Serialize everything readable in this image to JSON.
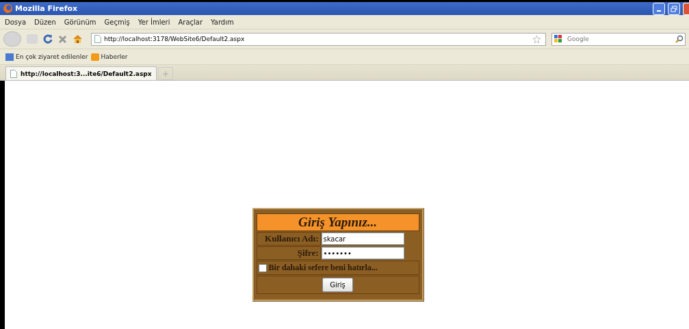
{
  "window": {
    "title": "Mozilla Firefox"
  },
  "menu": [
    "Dosya",
    "Düzen",
    "Görünüm",
    "Geçmiş",
    "Yer İmleri",
    "Araçlar",
    "Yardım"
  ],
  "address": {
    "value": "http://localhost:3178/WebSite6/Default2.aspx"
  },
  "search": {
    "placeholder": "Google"
  },
  "bookmarks": [
    "En çok ziyaret edilenler",
    "Haberler"
  ],
  "tabs": [
    {
      "label": "http://localhost:3...ite6/Default2.aspx",
      "selected": true
    }
  ],
  "login": {
    "title": "Giriş Yapınız...",
    "username_label": "Kullanıcı Adı:",
    "username": "skacar",
    "password_label": "Şifre:",
    "password": "•••••••",
    "remember": {
      "label": "Bir dahaki sefere beni hatırla...",
      "checked": false
    },
    "button": "Giriş"
  }
}
